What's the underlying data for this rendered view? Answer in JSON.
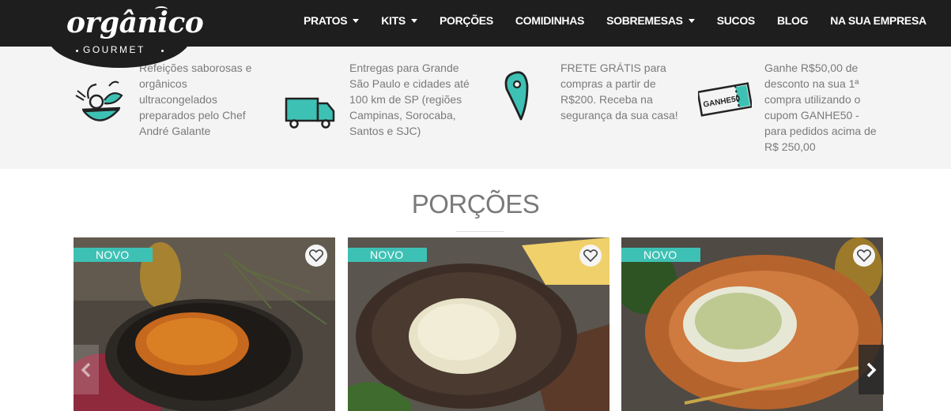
{
  "logo": {
    "name": "orgânico",
    "tagline": "GOURMET"
  },
  "nav": {
    "items": [
      {
        "label": "PRATOS",
        "dropdown": true
      },
      {
        "label": "KITS",
        "dropdown": true
      },
      {
        "label": "PORÇÕES",
        "dropdown": false
      },
      {
        "label": "COMIDINHAS",
        "dropdown": false
      },
      {
        "label": "SOBREMESAS",
        "dropdown": true
      },
      {
        "label": "SUCOS",
        "dropdown": false
      },
      {
        "label": "BLOG",
        "dropdown": false
      },
      {
        "label": "NA SUA EMPRESA",
        "dropdown": false
      }
    ]
  },
  "features": [
    {
      "icon": "salad-bowl-icon",
      "text": "Refeições saborosas e orgânicos ultracongelados preparados pelo Chef André Galante"
    },
    {
      "icon": "delivery-truck-icon",
      "text": "Entregas para Grande São Paulo e cidades até 100 km de SP (regiões Campinas, Sorocaba, Santos e SJC)"
    },
    {
      "icon": "location-pin-icon",
      "text": "FRETE GRÁTIS para compras a partir de R$200. Receba na segurança da sua casa!"
    },
    {
      "icon": "coupon-ticket-icon",
      "text": "Ganhe R$50,00 de desconto na sua 1ª compra utilizando o cupom GANHE50 - para pedidos acima de R$ 250,00",
      "ticket_label": "GANHE50"
    }
  ],
  "section": {
    "title": "PORÇÕES"
  },
  "products": [
    {
      "badge": "NOVO",
      "image": "sweet-potato-cubes-dish"
    },
    {
      "badge": "NOVO",
      "image": "risotto-plate"
    },
    {
      "badge": "NOVO",
      "image": "broccoli-rice-plate"
    }
  ],
  "colors": {
    "header_bg": "#1e1e1e",
    "accent": "#3ec1b5",
    "band_bg": "#f4f4f4",
    "text_muted": "#7a7a7a"
  },
  "carousel": {
    "prev_icon": "chevron-left-icon",
    "next_icon": "chevron-right-icon"
  }
}
